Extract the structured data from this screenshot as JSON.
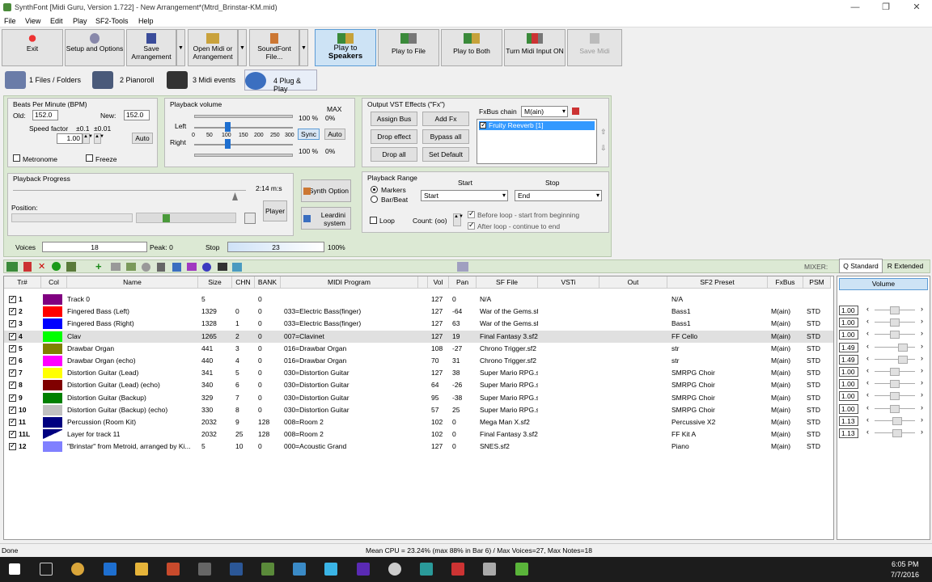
{
  "window": {
    "title": "SynthFont [Midi Guru, Version 1.722] - New Arrangement*(Mtrd_Brinstar-KM.mid)",
    "minimize": "—",
    "restore": "❐",
    "close": "✕"
  },
  "menu": [
    "File",
    "View",
    "Edit",
    "Play",
    "SF2-Tools",
    "Help"
  ],
  "toolbar": {
    "exit": "Exit",
    "setup": "Setup and Options",
    "save1": "Save",
    "save2": "Arrangement",
    "open1": "Open Midi or",
    "open2": "Arrangement",
    "sf1": "SoundFont",
    "sf2": "File...",
    "play1": "Play to",
    "play2": "Speakers",
    "file": "Play to File",
    "both": "Play to Both",
    "midi": "Turn Midi Input ON",
    "savemidi": "Save Midi"
  },
  "tabs": [
    "1 Files / Folders",
    "2 Pianoroll",
    "3 Midi events",
    "4 Plug & Play"
  ],
  "bpm": {
    "title": "Beats Per Minute (BPM)",
    "old_label": "Old:",
    "old": "152.0",
    "new_label": "New:",
    "new": "152.0",
    "speed_label": "Speed factor",
    "step1": "±0.1",
    "step2": "±0.01",
    "speed": "1.00",
    "auto": "Auto",
    "metronome": "Metronome",
    "freeze": "Freeze"
  },
  "volume": {
    "title": "Playback volume",
    "max": "MAX",
    "left": "Left",
    "right": "Right",
    "ticks": [
      "0",
      "50",
      "100",
      "150",
      "200",
      "250",
      "300"
    ],
    "lpct": "100 %",
    "rpct": "100 %",
    "lmax": "0%",
    "rmax": "0%",
    "sync": "Sync",
    "auto": "Auto",
    "level": 100
  },
  "vst": {
    "title": "Output VST Effects (\"Fx\")",
    "assign": "Assign Bus",
    "addfx": "Add Fx",
    "drop": "Drop effect",
    "bypass": "Bypass all",
    "dropall": "Drop all",
    "setdef": "Set Default",
    "chain_label": "FxBus chain",
    "chain": "M(ain)",
    "item": "Fruity Reeverb [1]"
  },
  "progress": {
    "title": "Playback Progress",
    "time": "2:14 m:s",
    "position": "Position:",
    "player": "Player",
    "synth": "Synth Option",
    "leardini1": "Leardini",
    "leardini2": "system",
    "progress": 0.95
  },
  "range": {
    "title": "Playback Range",
    "start_label": "Start",
    "stop_label": "Stop",
    "markers": "Markers",
    "barbeat": "Bar/Beat",
    "start": "Start",
    "end": "End",
    "loop": "Loop",
    "count": "Count: (oo)",
    "before": "Before loop - start from beginning",
    "after": "After loop - continue to end"
  },
  "voices": {
    "label": "Voices",
    "value": "18",
    "peak": "Peak: 0",
    "stop": "Stop",
    "stopval": "23",
    "pct": "100%"
  },
  "mixer_label": "MIXER:",
  "mixer_tabs": [
    "Q Standard",
    "R Extended"
  ],
  "mixer_head": "Volume",
  "columns": [
    "Tr#",
    "Col",
    "Name",
    "Size",
    "CHN",
    "BANK",
    "MIDI Program",
    "Vol",
    "Pan",
    "SF File",
    "VSTi",
    "Out",
    "SF2 Preset",
    "FxBus",
    "PSM"
  ],
  "tracks": [
    {
      "num": "1",
      "color": "#800080",
      "name": "Track 0",
      "size": "5",
      "chn": "",
      "bank": "0",
      "prog": "",
      "vol": "127",
      "pan": "0",
      "sf": "N/A",
      "preset": "N/A",
      "fx": "",
      "psm": ""
    },
    {
      "num": "2",
      "color": "#ff0000",
      "name": "Fingered Bass (Left)",
      "size": "1329",
      "chn": "0",
      "bank": "0",
      "prog": "033=Electric Bass(finger)",
      "vol": "127",
      "pan": "-64",
      "sf": "War of the Gems.sf2",
      "preset": "Bass1",
      "fx": "M(ain)",
      "psm": "STD",
      "mix": "1.00",
      "lvl": 0.5
    },
    {
      "num": "3",
      "color": "#0000ff",
      "name": "Fingered Bass (Right)",
      "size": "1328",
      "chn": "1",
      "bank": "0",
      "prog": "033=Electric Bass(finger)",
      "vol": "127",
      "pan": "63",
      "sf": "War of the Gems.sf2",
      "preset": "Bass1",
      "fx": "M(ain)",
      "psm": "STD",
      "mix": "1.00",
      "lvl": 0.5
    },
    {
      "num": "4",
      "color": "#00ff00",
      "name": "Clav",
      "size": "1265",
      "chn": "2",
      "bank": "0",
      "prog": "007=Clavinet",
      "vol": "127",
      "pan": "19",
      "sf": "Final Fantasy 3.sf2",
      "preset": "FF Cello",
      "fx": "M(ain)",
      "psm": "STD",
      "mix": "1.00",
      "lvl": 0.5,
      "selected": true
    },
    {
      "num": "5",
      "color": "#808000",
      "name": "Drawbar Organ",
      "size": "441",
      "chn": "3",
      "bank": "0",
      "prog": "016=Drawbar Organ",
      "vol": "108",
      "pan": "-27",
      "sf": "Chrono Trigger.sf2",
      "preset": "str",
      "fx": "M(ain)",
      "psm": "STD",
      "mix": "1.49",
      "lvl": 0.75
    },
    {
      "num": "6",
      "color": "#ff00ff",
      "name": "Drawbar Organ (echo)",
      "size": "440",
      "chn": "4",
      "bank": "0",
      "prog": "016=Drawbar Organ",
      "vol": "70",
      "pan": "31",
      "sf": "Chrono Trigger.sf2",
      "preset": "str",
      "fx": "M(ain)",
      "psm": "STD",
      "mix": "1.49",
      "lvl": 0.75
    },
    {
      "num": "7",
      "color": "#ffff00",
      "name": "Distortion Guitar (Lead)",
      "size": "341",
      "chn": "5",
      "bank": "0",
      "prog": "030=Distortion Guitar",
      "vol": "127",
      "pan": "38",
      "sf": "Super Mario RPG.sf2",
      "preset": "SMRPG Choir",
      "fx": "M(ain)",
      "psm": "STD",
      "mix": "1.00",
      "lvl": 0.5
    },
    {
      "num": "8",
      "color": "#800000",
      "name": "Distortion Guitar (Lead) (echo)",
      "size": "340",
      "chn": "6",
      "bank": "0",
      "prog": "030=Distortion Guitar",
      "vol": "64",
      "pan": "-26",
      "sf": "Super Mario RPG.sf2",
      "preset": "SMRPG Choir",
      "fx": "M(ain)",
      "psm": "STD",
      "mix": "1.00",
      "lvl": 0.5
    },
    {
      "num": "9",
      "color": "#008000",
      "name": "Distortion Guitar (Backup)",
      "size": "329",
      "chn": "7",
      "bank": "0",
      "prog": "030=Distortion Guitar",
      "vol": "95",
      "pan": "-38",
      "sf": "Super Mario RPG.sf2",
      "preset": "SMRPG Choir",
      "fx": "M(ain)",
      "psm": "STD",
      "mix": "1.00",
      "lvl": 0.5
    },
    {
      "num": "10",
      "color": "#c0c0c0",
      "name": "Distortion Guitar (Backup) (echo)",
      "size": "330",
      "chn": "8",
      "bank": "0",
      "prog": "030=Distortion Guitar",
      "vol": "57",
      "pan": "25",
      "sf": "Super Mario RPG.sf2",
      "preset": "SMRPG Choir",
      "fx": "M(ain)",
      "psm": "STD",
      "mix": "1.00",
      "lvl": 0.5
    },
    {
      "num": "11",
      "color": "#000080",
      "name": "Percussion (Room Kit)",
      "size": "2032",
      "chn": "9",
      "bank": "128",
      "prog": "008=Room 2",
      "vol": "102",
      "pan": "0",
      "sf": "Mega Man X.sf2",
      "preset": "Percussive X2",
      "fx": "M(ain)",
      "psm": "STD",
      "mix": "1.13",
      "lvl": 0.57
    },
    {
      "num": "11L",
      "color": "#000080",
      "name": "Layer for track 11",
      "size": "2032",
      "chn": "25",
      "bank": "128",
      "prog": "008=Room 2",
      "vol": "102",
      "pan": "0",
      "sf": "Final Fantasy 3.sf2",
      "preset": "FF Kit A",
      "fx": "M(ain)",
      "psm": "STD",
      "mix": "1.13",
      "lvl": 0.57
    },
    {
      "num": "12",
      "color": "#8080ff",
      "name": "\"Brinstar\" from Metroid, arranged by Ki...",
      "size": "5",
      "chn": "10",
      "bank": "0",
      "prog": "000=Acoustic Grand",
      "vol": "127",
      "pan": "0",
      "sf": "SNES.sf2",
      "preset": "Piano",
      "fx": "M(ain)",
      "psm": "STD"
    }
  ],
  "status": {
    "left": "Done",
    "center": "Mean CPU = 23.24% (max 88% in Bar 6) / Max Voices=27, Max Notes=18"
  },
  "clock": {
    "time": "6:05 PM",
    "date": "7/7/2016"
  }
}
